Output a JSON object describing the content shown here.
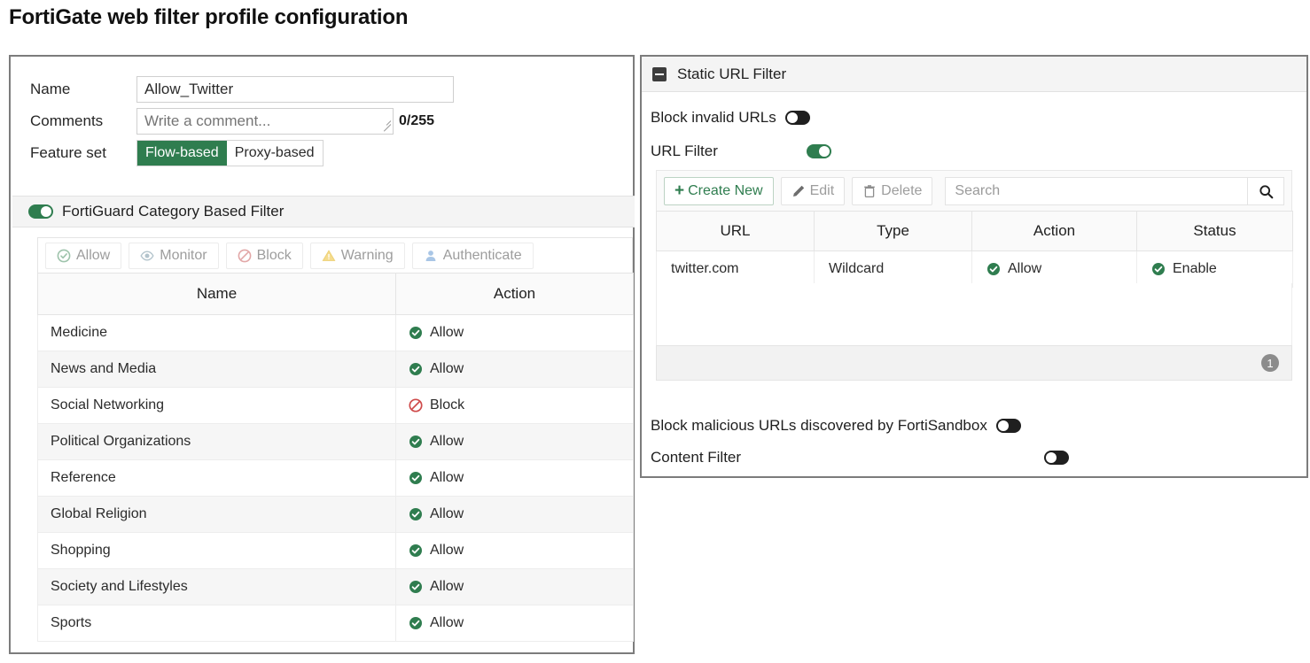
{
  "page": {
    "title": "FortiGate web filter profile configuration"
  },
  "colors": {
    "accent_green": "#2f7d4f",
    "block_red": "#cf4b4b",
    "warning_yellow": "#f2c94c",
    "auth_blue": "#8fb6e0",
    "toggle_off": "#1f1f1f",
    "panel_border": "#7c7c7c"
  },
  "left_panel": {
    "fields": {
      "name_label": "Name",
      "name_value": "Allow_Twitter",
      "comments_label": "Comments",
      "comments_value": "",
      "comments_placeholder": "Write a comment...",
      "char_counter": "0/255",
      "feature_set_label": "Feature set",
      "feature_set_options": [
        "Flow-based",
        "Proxy-based"
      ],
      "feature_set_selected": "Flow-based"
    },
    "section": {
      "label": "FortiGuard Category Based Filter",
      "toggle_state": "on"
    },
    "action_toolbar": [
      {
        "label": "Allow",
        "icon": "check-circle-icon",
        "enabled": false
      },
      {
        "label": "Monitor",
        "icon": "eye-icon",
        "enabled": false
      },
      {
        "label": "Block",
        "icon": "block-circle-icon",
        "enabled": false
      },
      {
        "label": "Warning",
        "icon": "warning-triangle-icon",
        "enabled": false
      },
      {
        "label": "Authenticate",
        "icon": "user-icon",
        "enabled": false
      }
    ],
    "table": {
      "columns": [
        "Name",
        "Action"
      ],
      "rows": [
        {
          "name": "Medicine",
          "action": "Allow",
          "action_icon": "check-circle-icon"
        },
        {
          "name": "News and Media",
          "action": "Allow",
          "action_icon": "check-circle-icon"
        },
        {
          "name": "Social Networking",
          "action": "Block",
          "action_icon": "block-circle-icon"
        },
        {
          "name": "Political Organizations",
          "action": "Allow",
          "action_icon": "check-circle-icon"
        },
        {
          "name": "Reference",
          "action": "Allow",
          "action_icon": "check-circle-icon"
        },
        {
          "name": "Global Religion",
          "action": "Allow",
          "action_icon": "check-circle-icon"
        },
        {
          "name": "Shopping",
          "action": "Allow",
          "action_icon": "check-circle-icon"
        },
        {
          "name": "Society and Lifestyles",
          "action": "Allow",
          "action_icon": "check-circle-icon"
        },
        {
          "name": "Sports",
          "action": "Allow",
          "action_icon": "check-circle-icon"
        }
      ]
    }
  },
  "right_panel": {
    "header": {
      "label": "Static URL Filter",
      "collapse_icon": "collapse-minus-icon"
    },
    "toggles": [
      {
        "label": "Block invalid URLs",
        "state": "off"
      },
      {
        "label": "URL Filter",
        "state": "on"
      }
    ],
    "toolbar": {
      "create_new": "Create New",
      "edit": "Edit",
      "delete": "Delete",
      "search_placeholder": "Search",
      "search_value": ""
    },
    "table": {
      "columns": [
        "URL",
        "Type",
        "Action",
        "Status"
      ],
      "rows": [
        {
          "url": "twitter.com",
          "type": "Wildcard",
          "action": "Allow",
          "action_icon": "check-circle-icon",
          "status": "Enable",
          "status_icon": "check-circle-icon"
        }
      ],
      "row_count": "1"
    },
    "bottom_toggles": [
      {
        "label": "Block malicious URLs discovered by FortiSandbox",
        "state": "off"
      },
      {
        "label": "Content Filter",
        "state": "off"
      }
    ]
  }
}
